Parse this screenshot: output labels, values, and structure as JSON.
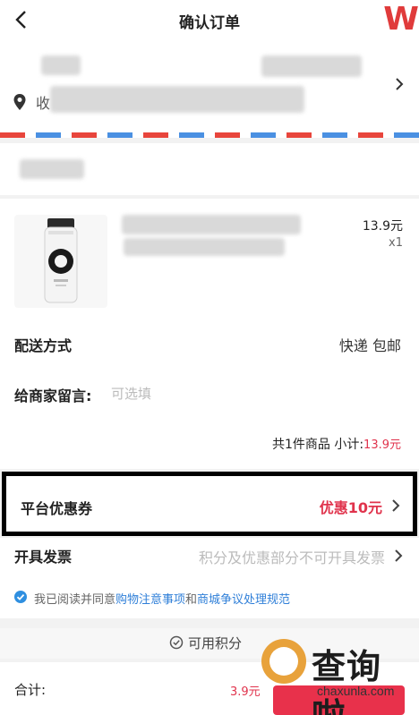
{
  "header": {
    "title": "确认订单",
    "brand_glyph": "W"
  },
  "address": {
    "prefix": "收"
  },
  "product": {
    "price": "13.9元",
    "quantity": "x1"
  },
  "delivery": {
    "label": "配送方式",
    "value": "快递  包邮"
  },
  "message": {
    "label": "给商家留言:",
    "placeholder": "可选填"
  },
  "subtotal": {
    "label": "共1件商品  小计:",
    "amount": "13.9元"
  },
  "coupon": {
    "label": "平台优惠券",
    "value": "优惠10元"
  },
  "invoice": {
    "label": "开具发票",
    "note": "积分及优惠部分不可开具发票"
  },
  "agreement": {
    "prefix": "我已阅读并同意",
    "link1": "购物注意事项",
    "joiner": "和",
    "link2": "商城争议处理规范"
  },
  "points": {
    "label": "可用积分"
  },
  "footer": {
    "total_label": "合计:",
    "total_amount": "3.9元"
  },
  "watermark": {
    "name": "查询啦",
    "domain": "chaxunla.com"
  },
  "colors": {
    "accent": "#e0334c",
    "link": "#2f7fd8",
    "watermark_orange": "#e8a23b"
  }
}
